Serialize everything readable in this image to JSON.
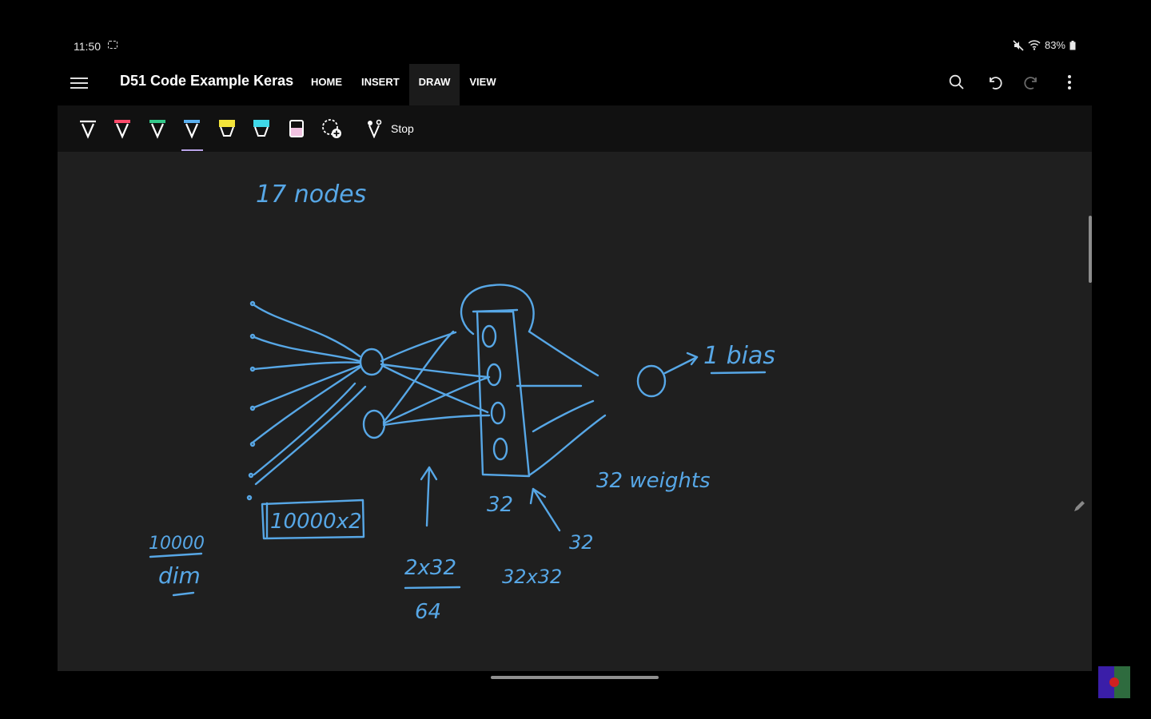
{
  "status": {
    "time": "11:50",
    "battery": "83%"
  },
  "app": {
    "title": "D51 Code Example Keras"
  },
  "tabs": [
    {
      "label": "HOME",
      "active": false
    },
    {
      "label": "INSERT",
      "active": false
    },
    {
      "label": "DRAW",
      "active": true
    },
    {
      "label": "VIEW",
      "active": false
    }
  ],
  "actions": [
    "search-icon",
    "undo-icon",
    "redo-icon",
    "more-vert-icon"
  ],
  "ribbon": {
    "tools": [
      {
        "name": "pen-white",
        "color": "#ffffff"
      },
      {
        "name": "pen-red",
        "color": "#ff4a6a"
      },
      {
        "name": "pen-green",
        "color": "#33c98a"
      },
      {
        "name": "pen-blue",
        "color": "#5ab0f0"
      },
      {
        "name": "highlighter-yellow",
        "color": "#f3e43a"
      },
      {
        "name": "highlighter-cyan",
        "color": "#3fd8e8"
      },
      {
        "name": "highlighter-pink",
        "color": "#f1c2e1"
      },
      {
        "name": "lasso-add",
        "color": "#ffffff"
      }
    ],
    "stop_label": "Stop"
  },
  "ink_color": "#57a7e6",
  "notes": {
    "title": "17 nodes",
    "bias": "1 bias",
    "n10000": "10000",
    "dim": "dim",
    "box": "10000x2",
    "w2x32": "2x32",
    "w64": "64",
    "w32a": "32",
    "w32b": "32",
    "w32x32": "32x32",
    "weights": "32 weights"
  }
}
